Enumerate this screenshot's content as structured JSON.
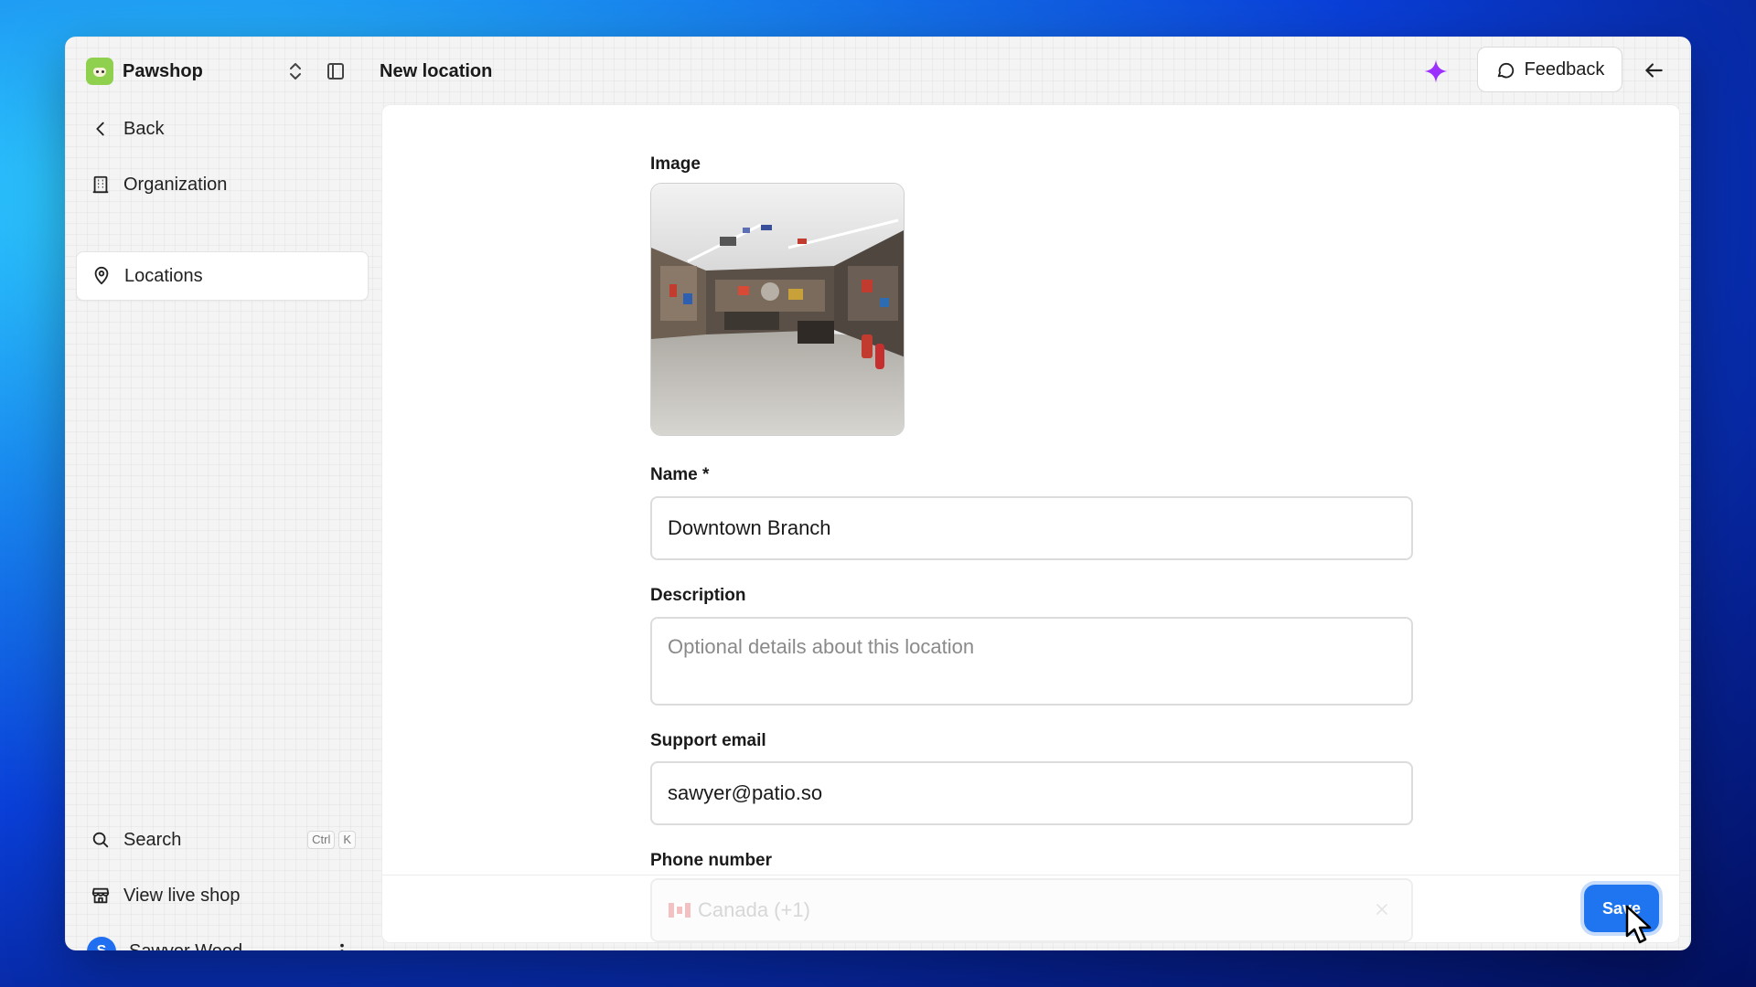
{
  "app": {
    "brand_name": "Pawshop",
    "page_title": "New location"
  },
  "header": {
    "feedback_label": "Feedback"
  },
  "sidebar": {
    "back_label": "Back",
    "items": [
      {
        "label": "Organization",
        "icon": "building-icon",
        "active": false
      },
      {
        "label": "Locations",
        "icon": "map-pin-icon",
        "active": true
      }
    ],
    "search_label": "Search",
    "search_shortcut": [
      "Ctrl",
      "K"
    ],
    "view_live_shop_label": "View live shop",
    "user": {
      "initial": "S",
      "name": "Sawyer Wood"
    }
  },
  "form": {
    "image_label": "Image",
    "name_label": "Name *",
    "name_value": "Downtown Branch",
    "description_label": "Description",
    "description_placeholder": "Optional details about this location",
    "support_email_label": "Support email",
    "support_email_value": "sawyer@patio.so",
    "phone_label": "Phone number",
    "phone_country": "Canada (+1)"
  },
  "footer": {
    "save_label": "Save"
  },
  "colors": {
    "accent": "#1f74f0",
    "brand_logo": "#8fd14f",
    "sparkle": "#9b30ff"
  }
}
